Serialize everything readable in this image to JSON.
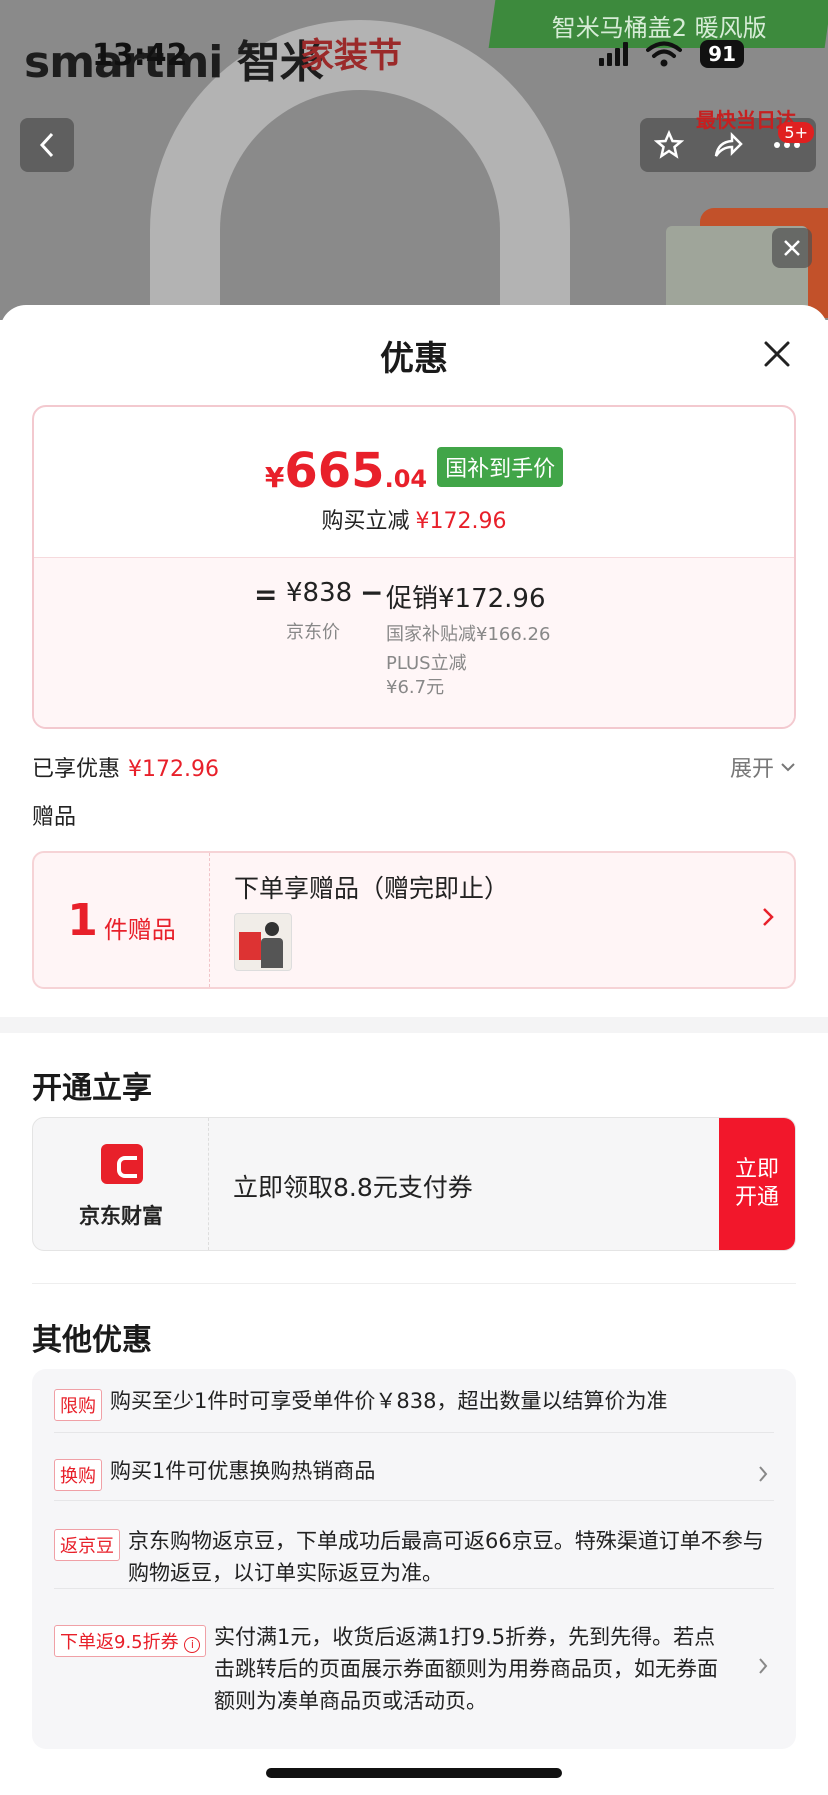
{
  "status_bar": {
    "time": "13:42",
    "battery": "91"
  },
  "background": {
    "brand": "smartmi 智米",
    "festival": "家装节",
    "banner": "智米马桶盖2 暖风版",
    "side_tag": "最快当日达",
    "badge": "5+"
  },
  "sheet": {
    "title": "优惠",
    "price": {
      "currency": "¥",
      "integer": "665",
      "decimal": ".04",
      "gov_tag": "国补到手价",
      "instant_label": "购买立减",
      "instant_value": "¥172.96",
      "equals": "=",
      "jd_price": "¥838",
      "jd_label": "京东价",
      "minus": "−",
      "promo": "促销¥172.96",
      "promo_sub1": "国家补贴减¥166.26",
      "promo_sub2": "PLUS立减¥6.7元"
    },
    "enjoyed_label": "已享优惠",
    "enjoyed_value": "¥172.96",
    "expand": "展开",
    "gift_section": "赠品",
    "gift": {
      "count": "1",
      "count_label": "件赠品",
      "title": "下单享赠品（赠完即止）"
    },
    "open_section": "开通立享",
    "open": {
      "brand": "京东财富",
      "text": "立即领取8.8元支付券",
      "button": "立即开通"
    },
    "other_section": "其他优惠",
    "other": [
      {
        "tag": "限购",
        "text": "购买至少1件时可享受单件价￥838，超出数量以结算价为准"
      },
      {
        "tag": "换购",
        "text": "购买1件可优惠换购热销商品"
      },
      {
        "tag": "返京豆",
        "text": "京东购物返京豆，下单成功后最高可返66京豆。特殊渠道订单不参与购物返豆，以订单实际返豆为准。"
      },
      {
        "tag": "下单返9.5折券",
        "text": "实付满1元，收货后返满1打9.5折券，先到先得。若点击跳转后的页面展示券面额则为用券商品页，如无券面额则为凑单商品页或活动页。"
      }
    ]
  },
  "colors": {
    "accent": "#e8202a",
    "gov_green": "#41a548"
  }
}
